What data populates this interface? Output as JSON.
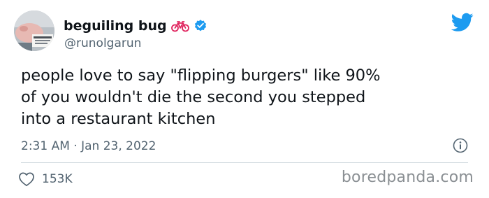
{
  "user": {
    "display_name": "beguiling bug",
    "handle": "@runolgarun",
    "name_emoji_icon": "bicycle-icon",
    "verified_icon": "verified-badge-icon",
    "avatar_icon": "avatar-photo"
  },
  "brand": {
    "icon": "twitter-bird-icon",
    "color": "#1d9bf0"
  },
  "tweet": {
    "text": "people love to say \"flipping burgers\" like 90%\nof you wouldn't die the second you stepped\ninto a restaurant kitchen",
    "timestamp": "2:31 AM · Jan 23, 2022",
    "info_icon": "info-circle-icon"
  },
  "engagement": {
    "like_icon": "heart-icon",
    "like_count": "153K"
  },
  "watermark": {
    "text": "boredpanda.com"
  },
  "colors": {
    "text_primary": "#0f1419",
    "text_secondary": "#536471",
    "bicycle": "#e0245e",
    "divider": "#cfd9de",
    "watermark": "#8a8f93"
  }
}
